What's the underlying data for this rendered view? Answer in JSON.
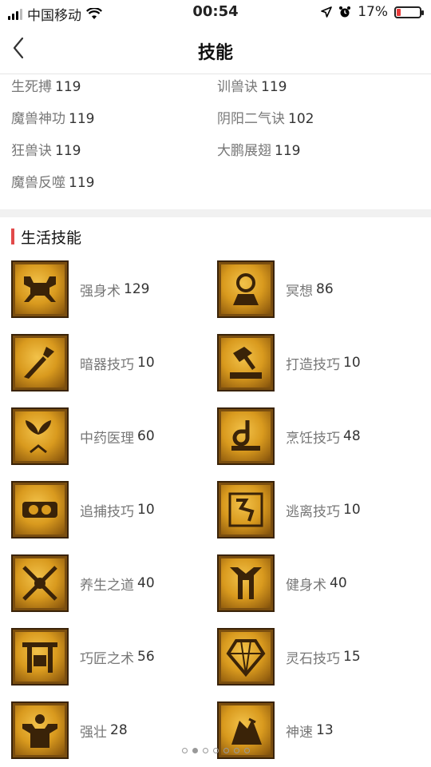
{
  "status": {
    "carrier": "中国移动",
    "time": "00:54",
    "battery": "17%"
  },
  "nav": {
    "title": "技能"
  },
  "combat_skills": [
    {
      "name": "生死搏",
      "level": "119"
    },
    {
      "name": "训兽诀",
      "level": "119"
    },
    {
      "name": "魔兽神功",
      "level": "119"
    },
    {
      "name": "阴阳二气诀",
      "level": "102"
    },
    {
      "name": "狂兽诀",
      "level": "119"
    },
    {
      "name": "大鹏展翅",
      "level": "119"
    },
    {
      "name": "魔兽反噬",
      "level": "119"
    }
  ],
  "life_section": {
    "title": "生活技能",
    "accent_color": "#e24a4a"
  },
  "life_skills": [
    {
      "name": "强身术",
      "level": "129",
      "icon": "strength-icon"
    },
    {
      "name": "冥想",
      "level": "86",
      "icon": "meditation-icon"
    },
    {
      "name": "暗器技巧",
      "level": "10",
      "icon": "dart-icon"
    },
    {
      "name": "打造技巧",
      "level": "10",
      "icon": "hammer-icon"
    },
    {
      "name": "中药医理",
      "level": "60",
      "icon": "herb-icon"
    },
    {
      "name": "烹饪技巧",
      "level": "48",
      "icon": "cooking-icon"
    },
    {
      "name": "追捕技巧",
      "level": "10",
      "icon": "pursuit-icon"
    },
    {
      "name": "逃离技巧",
      "level": "10",
      "icon": "escape-icon"
    },
    {
      "name": "养生之道",
      "level": "40",
      "icon": "health-icon"
    },
    {
      "name": "健身术",
      "level": "40",
      "icon": "fitness-icon"
    },
    {
      "name": "巧匠之术",
      "level": "56",
      "icon": "craftsman-icon"
    },
    {
      "name": "灵石技巧",
      "level": "15",
      "icon": "spirit-stone-icon"
    },
    {
      "name": "强壮",
      "level": "28",
      "icon": "muscle-icon"
    },
    {
      "name": "神速",
      "level": "13",
      "icon": "speed-icon"
    }
  ],
  "pager": {
    "count": 7,
    "active_index": 1
  }
}
